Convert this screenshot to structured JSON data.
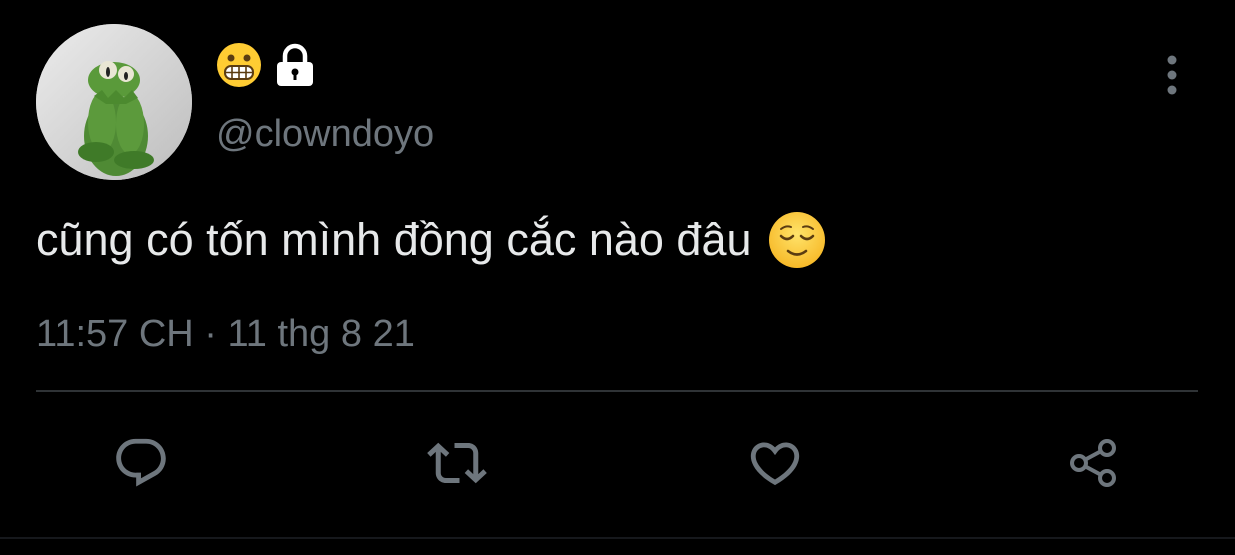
{
  "profile": {
    "avatar_icon": "kermit-avatar",
    "display_name_emoji_icon": "grimacing-face-icon",
    "protected_icon": "lock-icon",
    "handle": "@clowndoyo"
  },
  "tweet": {
    "text": "cũng có tốn mình đồng cắc nào đâu",
    "emoji_icon": "relieved-face-icon",
    "timestamp": "11:57 CH · 11 thg 8 21"
  },
  "actions": {
    "reply_icon": "reply-icon",
    "retweet_icon": "retweet-icon",
    "like_icon": "heart-icon",
    "share_icon": "share-icon",
    "more_icon": "more-vertical-icon"
  },
  "colors": {
    "background": "#000000",
    "text": "#e7e9ea",
    "muted": "#6e767d",
    "divider": "#2f3336"
  }
}
